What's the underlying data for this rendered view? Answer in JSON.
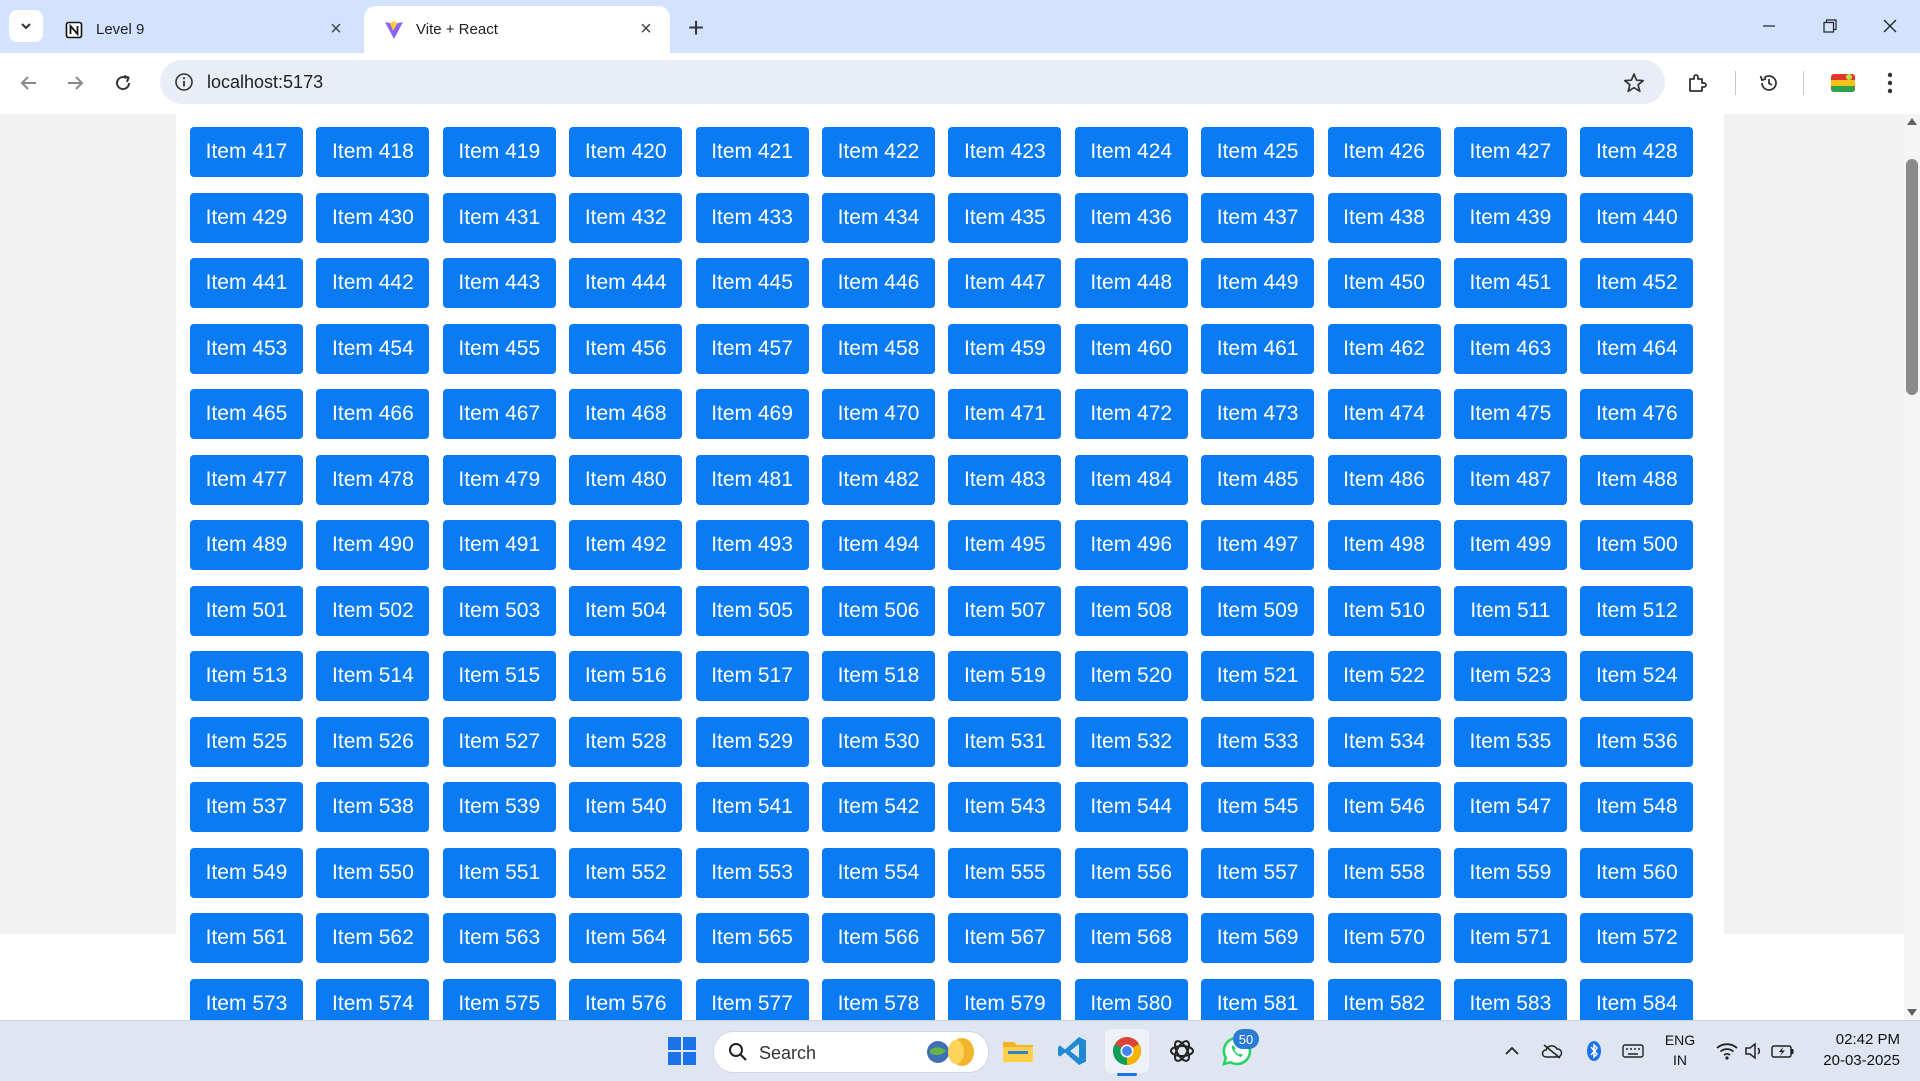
{
  "browser": {
    "tabs": [
      {
        "title": "Level 9",
        "icon": "notion-icon",
        "active": false
      },
      {
        "title": "Vite + React",
        "icon": "vite-icon",
        "active": true
      }
    ],
    "address": "localhost:5173"
  },
  "page": {
    "button_color": "#0a7bf3",
    "items": [
      "Item 417",
      "Item 418",
      "Item 419",
      "Item 420",
      "Item 421",
      "Item 422",
      "Item 423",
      "Item 424",
      "Item 425",
      "Item 426",
      "Item 427",
      "Item 428",
      "Item 429",
      "Item 430",
      "Item 431",
      "Item 432",
      "Item 433",
      "Item 434",
      "Item 435",
      "Item 436",
      "Item 437",
      "Item 438",
      "Item 439",
      "Item 440",
      "Item 441",
      "Item 442",
      "Item 443",
      "Item 444",
      "Item 445",
      "Item 446",
      "Item 447",
      "Item 448",
      "Item 449",
      "Item 450",
      "Item 451",
      "Item 452",
      "Item 453",
      "Item 454",
      "Item 455",
      "Item 456",
      "Item 457",
      "Item 458",
      "Item 459",
      "Item 460",
      "Item 461",
      "Item 462",
      "Item 463",
      "Item 464",
      "Item 465",
      "Item 466",
      "Item 467",
      "Item 468",
      "Item 469",
      "Item 470",
      "Item 471",
      "Item 472",
      "Item 473",
      "Item 474",
      "Item 475",
      "Item 476",
      "Item 477",
      "Item 478",
      "Item 479",
      "Item 480",
      "Item 481",
      "Item 482",
      "Item 483",
      "Item 484",
      "Item 485",
      "Item 486",
      "Item 487",
      "Item 488",
      "Item 489",
      "Item 490",
      "Item 491",
      "Item 492",
      "Item 493",
      "Item 494",
      "Item 495",
      "Item 496",
      "Item 497",
      "Item 498",
      "Item 499",
      "Item 500",
      "Item 501",
      "Item 502",
      "Item 503",
      "Item 504",
      "Item 505",
      "Item 506",
      "Item 507",
      "Item 508",
      "Item 509",
      "Item 510",
      "Item 511",
      "Item 512",
      "Item 513",
      "Item 514",
      "Item 515",
      "Item 516",
      "Item 517",
      "Item 518",
      "Item 519",
      "Item 520",
      "Item 521",
      "Item 522",
      "Item 523",
      "Item 524",
      "Item 525",
      "Item 526",
      "Item 527",
      "Item 528",
      "Item 529",
      "Item 530",
      "Item 531",
      "Item 532",
      "Item 533",
      "Item 534",
      "Item 535",
      "Item 536",
      "Item 537",
      "Item 538",
      "Item 539",
      "Item 540",
      "Item 541",
      "Item 542",
      "Item 543",
      "Item 544",
      "Item 545",
      "Item 546",
      "Item 547",
      "Item 548",
      "Item 549",
      "Item 550",
      "Item 551",
      "Item 552",
      "Item 553",
      "Item 554",
      "Item 555",
      "Item 556",
      "Item 557",
      "Item 558",
      "Item 559",
      "Item 560",
      "Item 561",
      "Item 562",
      "Item 563",
      "Item 564",
      "Item 565",
      "Item 566",
      "Item 567",
      "Item 568",
      "Item 569",
      "Item 570",
      "Item 571",
      "Item 572",
      "Item 573",
      "Item 574",
      "Item 575",
      "Item 576",
      "Item 577",
      "Item 578",
      "Item 579",
      "Item 580",
      "Item 581",
      "Item 582",
      "Item 583",
      "Item 584"
    ]
  },
  "taskbar": {
    "search_label": "Search",
    "apps": [
      "windows-start-icon",
      "file-explorer-icon",
      "vscode-icon",
      "chrome-icon",
      "chatgpt-icon",
      "whatsapp-icon"
    ],
    "whatsapp_badge": "50",
    "language": {
      "line1": "ENG",
      "line2": "IN"
    },
    "time": "02:42 PM",
    "date": "20-03-2025"
  }
}
